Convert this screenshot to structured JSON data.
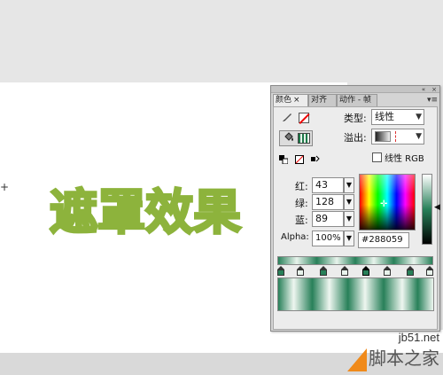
{
  "canvas": {
    "title_text": "遮罩效果",
    "crosshair": "+"
  },
  "panel": {
    "tabs": [
      {
        "label": "颜色",
        "close": "×"
      },
      {
        "label": "对齐"
      },
      {
        "label": "动作 - 帧"
      }
    ],
    "titlebar_buttons": [
      "«",
      "×"
    ],
    "menu": "▾≡",
    "type_label": "类型:",
    "type_value": "线性",
    "overflow_label": "溢出:",
    "linear_rgb_label": "线性 RGB",
    "red_label": "红:",
    "red_value": "43",
    "green_label": "绿:",
    "green_value": "128",
    "blue_label": "蓝:",
    "blue_value": "89",
    "alpha_label": "Alpha:",
    "alpha_value": "100%",
    "hex_value": "#288059",
    "colors": {
      "selected": "#288059",
      "light_stop": "#e8f3ec",
      "title_green": "#8db33c"
    },
    "gradient_stops": 8
  },
  "watermark": {
    "site": "jb51.net",
    "name": "脚本之家"
  }
}
